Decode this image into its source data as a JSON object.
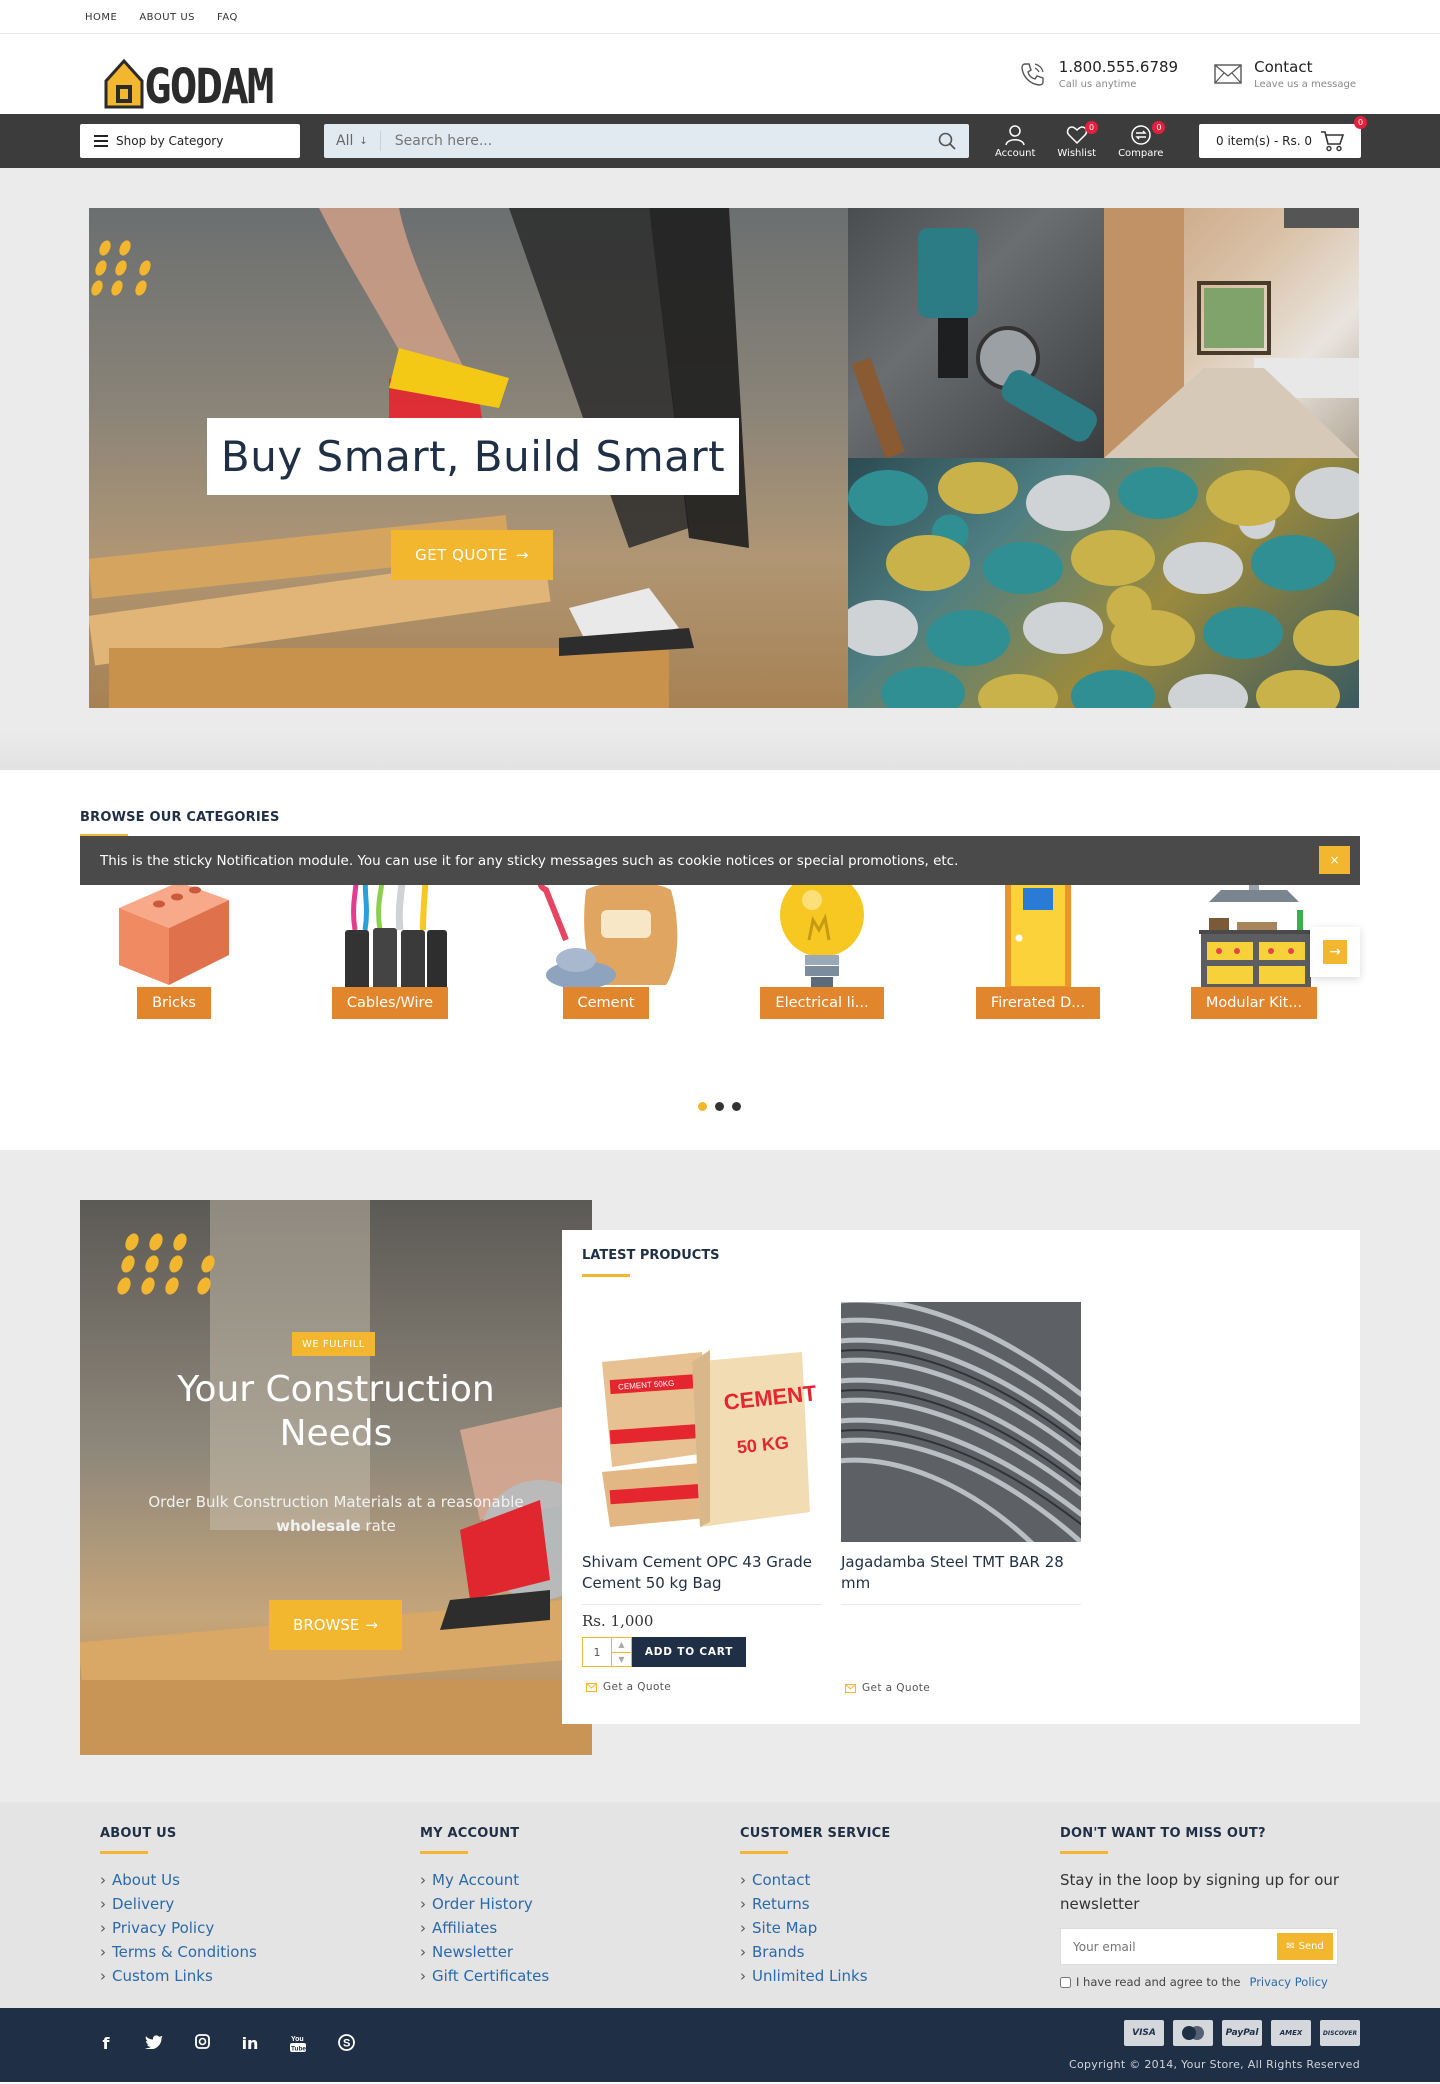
{
  "topnav": [
    "HOME",
    "ABOUT US",
    "FAQ"
  ],
  "logo": "GODAM",
  "contacts": [
    {
      "title": "1.800.555.6789",
      "sub": "Call us anytime",
      "icon": "phone-icon"
    },
    {
      "title": "Contact",
      "sub": "Leave us a message",
      "icon": "envelope-icon"
    }
  ],
  "nav": {
    "category_label": "Shop by Category",
    "search_scope": "All",
    "search_placeholder": "Search here...",
    "icons": [
      {
        "label": "Account",
        "badge": null
      },
      {
        "label": "Wishlist",
        "badge": "0"
      },
      {
        "label": "Compare",
        "badge": "0"
      }
    ],
    "cart_label": "0 item(s) - Rs. 0",
    "cart_badge": "0"
  },
  "hero": {
    "title": "Buy Smart, Build Smart",
    "button": "GET QUOTE"
  },
  "categories": {
    "title": "BROWSE OUR CATEGORIES",
    "notice": "This is the sticky Notification module. You can use it for any sticky messages such as cookie notices or special promotions, etc.",
    "notice_close": "×",
    "items": [
      "Bricks",
      "Cables/Wire",
      "Cement",
      "Electrical li...",
      "Firerated D...",
      "Modular Kit..."
    ]
  },
  "promo": {
    "tag": "WE FULFILL",
    "title_line1": "Your Construction",
    "title_line2": "Needs",
    "sub_line1": "Order Bulk Construction Materials at a reasonable",
    "sub_bold": "wholesale",
    "sub_after": "rate",
    "button": "BROWSE"
  },
  "latest": {
    "title": "LATEST PRODUCTS",
    "products": [
      {
        "name": "Shivam Cement OPC 43 Grade Cement 50 kg Bag",
        "price": "Rs. 1,000",
        "qty": "1",
        "add_to_cart": "ADD TO CART",
        "quote": "Get a Quote"
      },
      {
        "name": "Jagadamba Steel TMT BAR 28 mm",
        "price": "",
        "quote": "Get a Quote"
      }
    ],
    "bag_text1": "CEMENT 50KG",
    "bag_text2": "CEMENT",
    "bag_text3": "50 KG"
  },
  "footer": {
    "about_title": "ABOUT US",
    "about_links": [
      "About Us",
      "Delivery",
      "Privacy Policy",
      "Terms & Conditions",
      "Custom Links"
    ],
    "account_title": "MY ACCOUNT",
    "account_links": [
      "My Account",
      "Order History",
      "Affiliates",
      "Newsletter",
      "Gift Certificates"
    ],
    "service_title": "CUSTOMER SERVICE",
    "service_links": [
      "Contact",
      "Returns",
      "Site Map",
      "Brands",
      "Unlimited Links"
    ],
    "news_title": "DON'T WANT TO MISS OUT?",
    "news_text": "Stay in the loop by signing up for our newsletter",
    "email_placeholder": "Your email",
    "send": "Send",
    "agree": "I have read and agree to the",
    "privacy": "Privacy Policy",
    "social": [
      "f",
      "t",
      "ig",
      "in",
      "yt",
      "s"
    ],
    "payments": [
      "VISA",
      "MC",
      "PayPal",
      "AMEX",
      "DISCOVER"
    ],
    "copyright": "Copyright © 2014, Your Store, All Rights Reserved"
  },
  "colors": {
    "accent": "#f2b62f",
    "navy": "#1f2f45",
    "navbar": "#3c3c3c",
    "category_label": "#e2862e",
    "link": "#2b6aa8"
  }
}
